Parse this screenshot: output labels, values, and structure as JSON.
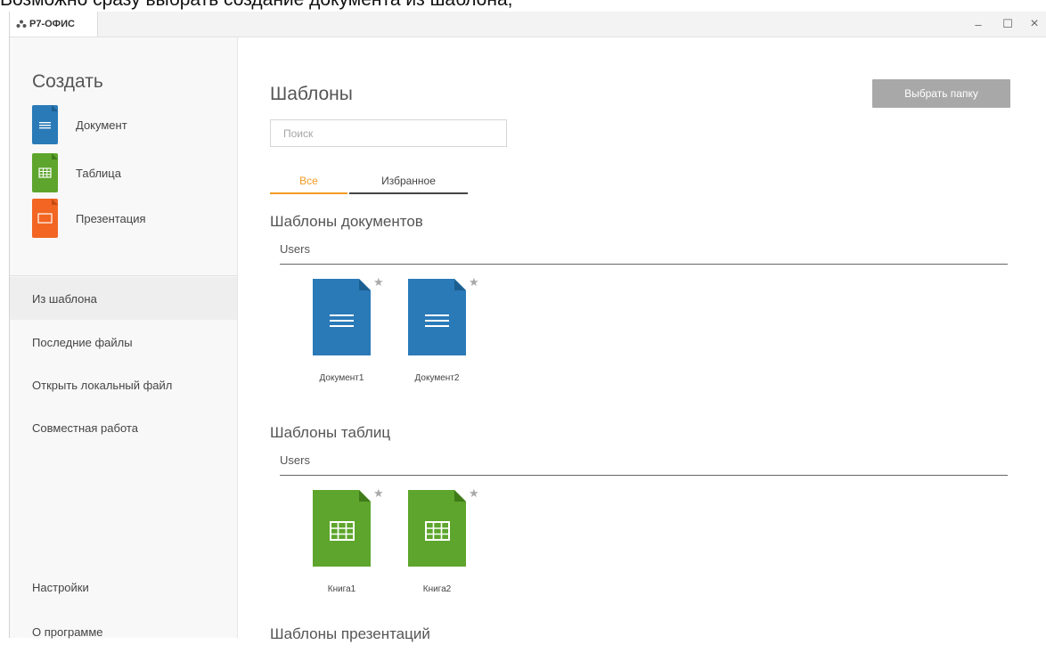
{
  "caption": "Возможно сразу выбрать создание документа из шаблона,",
  "window": {
    "app_name": "Р7-ОФИС",
    "minimize_glyph": "–",
    "maximize_glyph": "☐",
    "close_glyph": "×"
  },
  "sidebar": {
    "create_title": "Создать",
    "create_items": [
      {
        "label": "Документ",
        "icon": "document-icon",
        "color": "#2a7ab8"
      },
      {
        "label": "Таблица",
        "icon": "spreadsheet-icon",
        "color": "#5da52c"
      },
      {
        "label": "Презентация",
        "icon": "presentation-icon",
        "color": "#f26522"
      }
    ],
    "nav": [
      {
        "label": "Из шаблона",
        "active": true
      },
      {
        "label": "Последние файлы",
        "active": false
      },
      {
        "label": "Открыть локальный файл",
        "active": false
      },
      {
        "label": "Совместная работа",
        "active": false
      }
    ],
    "bottom_nav": [
      {
        "label": "Настройки"
      },
      {
        "label": "О программе"
      }
    ]
  },
  "main": {
    "title": "Шаблоны",
    "select_folder_label": "Выбрать папку",
    "search_placeholder": "Поиск",
    "tabs": [
      {
        "label": "Все",
        "active": true,
        "color": "#f39a24"
      },
      {
        "label": "Избранное",
        "active": false
      }
    ],
    "sections": [
      {
        "title": "Шаблоны документов",
        "group": "Users",
        "color": "#2a7ab8",
        "items": [
          {
            "name": "Документ1"
          },
          {
            "name": "Документ2"
          }
        ]
      },
      {
        "title": "Шаблоны таблиц",
        "group": "Users",
        "color": "#5da52c",
        "items": [
          {
            "name": "Книга1"
          },
          {
            "name": "Книга2"
          }
        ]
      },
      {
        "title": "Шаблоны презентаций"
      }
    ],
    "star_glyph": "★"
  }
}
